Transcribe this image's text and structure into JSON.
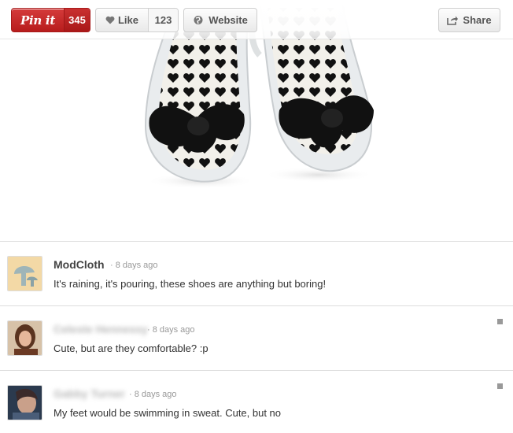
{
  "toolbar": {
    "pin_label": "Pin it",
    "pin_count": "345",
    "like_label": "Like",
    "like_count": "123",
    "website_label": "Website",
    "share_label": "Share"
  },
  "comments": [
    {
      "author": "ModCloth",
      "time": "8 days ago",
      "text": "It's raining, it's pouring, these shoes are anything but boring!",
      "avatar": "modcloth-logo"
    },
    {
      "author": "Celeste Hennessy",
      "time": "8 days ago",
      "text": "Cute, but are they comfortable? :p",
      "avatar": "user-photo"
    },
    {
      "author": "Gabby Turner",
      "time": "8 days ago",
      "text": "My feet would be swimming in sweat. Cute, but no",
      "avatar": "user-photo"
    }
  ],
  "colors": {
    "pin_red": "#c62828",
    "border": "#dcdcdc",
    "meta_gray": "#999999"
  }
}
